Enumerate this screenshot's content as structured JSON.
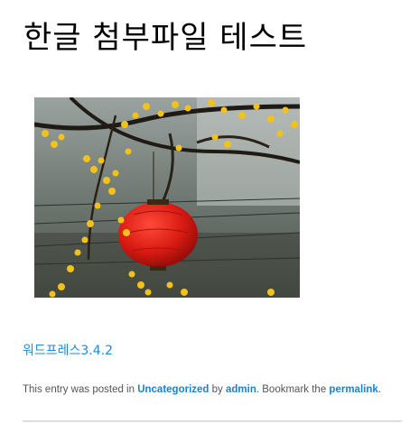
{
  "post": {
    "title": "한글 첨부파일 테스트",
    "attachment_link_text": "워드프레스3.4.2"
  },
  "image": {
    "description": "photo"
  },
  "meta": {
    "prefix": "This entry was posted in ",
    "category": "Uncategorized",
    "by": " by ",
    "author": "admin",
    "bookmark": ". Bookmark the ",
    "permalink": "permalink",
    "suffix": "."
  }
}
